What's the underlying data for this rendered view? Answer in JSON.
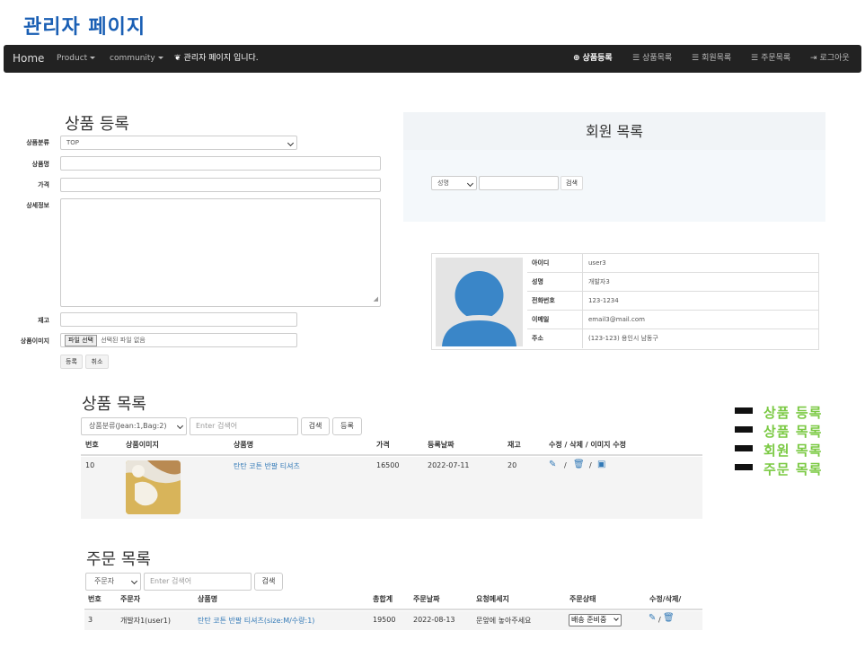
{
  "page": {
    "title": "관리자 페이지"
  },
  "navbar": {
    "brand": "Home",
    "product": "Product",
    "community": "community",
    "notice": "관리자 페이지 입니다.",
    "right": {
      "add_product": "상품등록",
      "product_list": "상품목록",
      "member_list": "회원목록",
      "order_list": "주문목록",
      "logout": "로그아웃"
    }
  },
  "product_form": {
    "title": "상품 등록",
    "labels": {
      "category": "상품분류",
      "name": "상품명",
      "price": "가격",
      "detail": "상세정보",
      "stock": "재고",
      "image": "상품이미지"
    },
    "category_value": "TOP",
    "file_button": "파일 선택",
    "file_status": "선택된 파일 없음",
    "submit": "등록",
    "cancel": "취소"
  },
  "member_panel": {
    "title": "회원 목록",
    "search_select": "성명",
    "search_button": "검색",
    "info": [
      {
        "key": "아이디",
        "value": "user3"
      },
      {
        "key": "성명",
        "value": "개발자3"
      },
      {
        "key": "전화번호",
        "value": "123-1234"
      },
      {
        "key": "이메일",
        "value": "email3@mail.com"
      },
      {
        "key": "주소",
        "value": "(123-123) 용인시 남동구"
      }
    ]
  },
  "product_list": {
    "title": "상품 목록",
    "filter_select": "상품분류(Jean:1,Bag:2)",
    "search_placeholder": "Enter 검색어",
    "search_button": "검색",
    "add_button": "등록",
    "headers": [
      "번호",
      "상품이미지",
      "상품명",
      "가격",
      "등록날짜",
      "재고",
      "수정 / 삭제 / 이미지 수정"
    ],
    "row": {
      "no": "10",
      "name": "탄탄 코튼 반팔 티셔츠",
      "price": "16500",
      "date": "2022-07-11",
      "stock": "20",
      "sep": "/"
    }
  },
  "order_list": {
    "title": "주문 목록",
    "filter_select": "주문자",
    "search_placeholder": "Enter 검색어",
    "search_button": "검색",
    "headers": [
      "번호",
      "주문자",
      "상품명",
      "총합계",
      "주문날짜",
      "요청메세지",
      "주문상태",
      "수정/삭제/"
    ],
    "row": {
      "no": "3",
      "orderer": "개발자1(user1)",
      "product": "탄탄 코튼 반팔 티셔츠(size:M/수량:1)",
      "total": "19500",
      "date": "2022-08-13",
      "message": "문앞에 놓아주세요",
      "status": "배송 준비중",
      "sep": "/"
    }
  },
  "legend": [
    "상품 등록",
    "상품 목록",
    "회원 목록",
    "주문 목록"
  ],
  "colors": {
    "accent": "#337ab7",
    "legend": "#7ac943",
    "title": "#1a5fb4",
    "navbar": "#222222"
  }
}
